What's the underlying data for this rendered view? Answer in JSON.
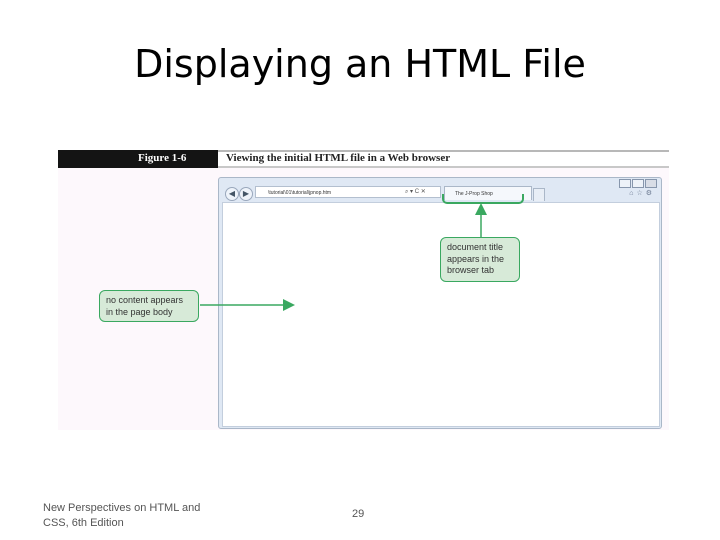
{
  "slide": {
    "title": "Displaying an HTML File",
    "footer": "New Perspectives on HTML and CSS, 6th Edition",
    "page_number": "29"
  },
  "figure": {
    "number": "Figure 1-6",
    "caption": "Viewing the initial HTML file in a Web browser",
    "browser": {
      "address": "\\tutorial\\01\\tutorial\\jpnop.htm",
      "tab_title": "The J-Prop Shop",
      "address_icons": "⌕ ▾ C ✕"
    },
    "callouts": {
      "title_callout": "document title appears in the browser tab",
      "body_callout": "no content appears in the page body"
    },
    "colors": {
      "callout_fill": "#d7ead8",
      "callout_border": "#3aa860",
      "header_black": "#141414"
    }
  }
}
